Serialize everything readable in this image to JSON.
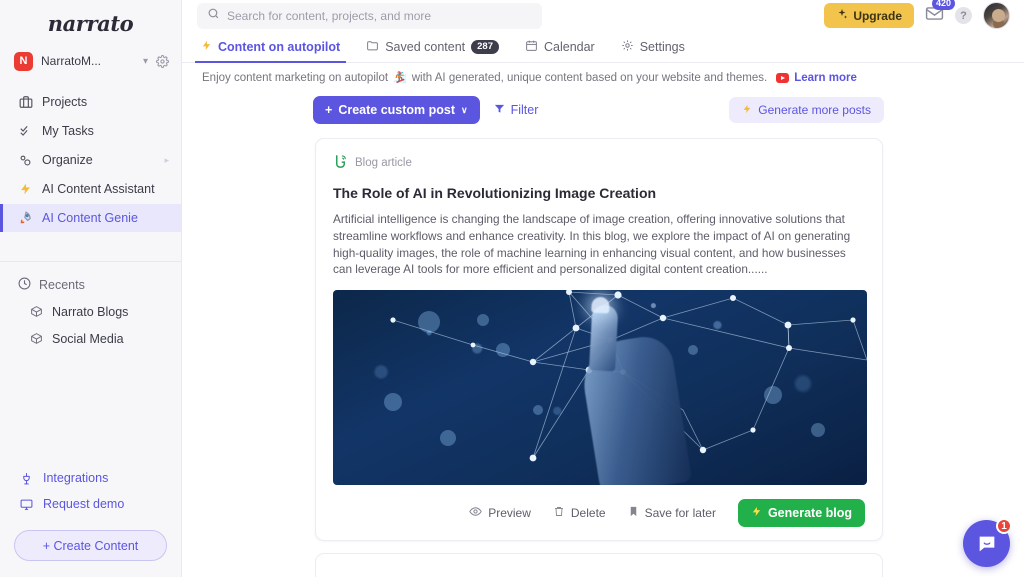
{
  "sidebar": {
    "brand": "narrato",
    "workspace": {
      "initial": "N",
      "name": "NarratoM...",
      "chevron": "chevron-down",
      "gear": "gear"
    },
    "nav": [
      {
        "label": "Projects",
        "icon": "briefcase-icon",
        "active": false
      },
      {
        "label": "My Tasks",
        "icon": "check-tasks-icon",
        "active": false
      },
      {
        "label": "Organize",
        "icon": "organize-icon",
        "active": false,
        "caret": "▸"
      },
      {
        "label": "AI Content Assistant",
        "icon": "lightning-icon",
        "active": false
      },
      {
        "label": "AI Content Genie",
        "icon": "rocket-icon",
        "active": true
      }
    ],
    "recents_label": "Recents",
    "recents": [
      {
        "label": "Narrato Blogs",
        "icon": "box-icon"
      },
      {
        "label": "Social Media",
        "icon": "box-icon"
      }
    ],
    "bottom_links": [
      {
        "label": "Integrations",
        "icon": "plug-icon"
      },
      {
        "label": "Request demo",
        "icon": "monitor-icon"
      }
    ],
    "create_content": "+ Create Content"
  },
  "topbar": {
    "search_placeholder": "Search for content, projects, and more",
    "search_value": "",
    "upgrade_label": "Upgrade",
    "mail_badge": "420",
    "help_label": "?"
  },
  "tabs": [
    {
      "label": "Content on autopilot",
      "icon": "lightning-icon",
      "active": true,
      "badge": ""
    },
    {
      "label": "Saved content",
      "icon": "folder-icon",
      "active": false,
      "badge": "287"
    },
    {
      "label": "Calendar",
      "icon": "calendar-icon",
      "active": false,
      "badge": ""
    },
    {
      "label": "Settings",
      "icon": "gear-icon",
      "active": false,
      "badge": ""
    }
  ],
  "banner": {
    "text_part1": "Enjoy content marketing on autopilot",
    "emoji": "🏂",
    "text_part2": "with AI generated, unique content based on your website and themes.",
    "learn_more": "Learn more"
  },
  "actions": {
    "create_post": "Create custom post",
    "create_post_plus": "+",
    "create_post_chevron": "∨",
    "filter": "Filter",
    "generate_more": "Generate more posts"
  },
  "card": {
    "type_label": "Blog article",
    "type_icon": "blogger-b-icon",
    "title": "The Role of AI in Revolutionizing Image Creation",
    "body": "Artificial intelligence is changing the landscape of image creation, offering innovative solutions that streamline workflows and enhance creativity. In this blog, we explore the impact of AI on generating high-quality images, the role of machine learning in enhancing visual content, and how businesses can leverage AI tools for more efficient and personalized digital content creation......",
    "image_alt": "robotic hand touching glowing network nodes on dark blue background",
    "footer": {
      "preview": "Preview",
      "delete": "Delete",
      "save_for_later": "Save for later",
      "generate_blog": "Generate blog"
    }
  },
  "chat": {
    "badge": "1",
    "icon": "chat-bubble-icon"
  },
  "colors": {
    "accent_purple": "#5b55e0",
    "accent_purple_light": "#eeecfc",
    "upgrade_yellow": "#f3c44b",
    "success_green": "#22b04b",
    "badge_red": "#e8453c",
    "workspace_red": "#ec3b33"
  }
}
